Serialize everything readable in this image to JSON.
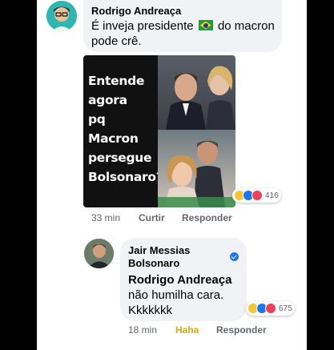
{
  "comment": {
    "author": "Rodrigo Andreaça",
    "text_before_flag": "É inveja presidente",
    "text_after_flag": "do macron",
    "text_line2": "pode crê.",
    "flag_icon": "brazil-flag-icon",
    "image_caption_lines": [
      "Entende",
      "agora",
      "pq Macron",
      "persegue",
      "Bolsonaro?"
    ],
    "reaction_count": "416",
    "time": "33 min",
    "like_label": "Curtir",
    "reply_label": "Responder"
  },
  "reply": {
    "author_line1": "Jair Messias",
    "author_line2": "Bolsonaro",
    "verified_icon": "verified-badge-icon",
    "mention": "Rodrigo Andreaça",
    "text_line1": "não humilha cara.",
    "text_line2": "Kkkkkkk",
    "reaction_count": "675",
    "time": "18 min",
    "reaction_label": "Haha",
    "reply_label": "Responder"
  },
  "colors": {
    "bubble": "#f0f2f5",
    "like_blue": "#1877f2",
    "haha_yellow": "#d9a41c",
    "meta_gray": "#65676b"
  }
}
